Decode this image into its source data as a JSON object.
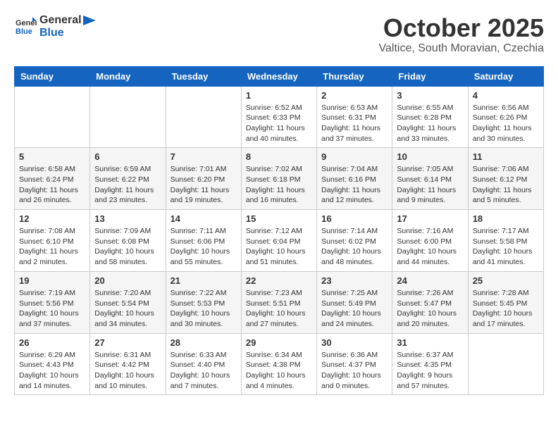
{
  "header": {
    "logo_general": "General",
    "logo_blue": "Blue",
    "month_title": "October 2025",
    "location": "Valtice, South Moravian, Czechia"
  },
  "days_of_week": [
    "Sunday",
    "Monday",
    "Tuesday",
    "Wednesday",
    "Thursday",
    "Friday",
    "Saturday"
  ],
  "weeks": [
    [
      {
        "day": "",
        "info": ""
      },
      {
        "day": "",
        "info": ""
      },
      {
        "day": "",
        "info": ""
      },
      {
        "day": "1",
        "info": "Sunrise: 6:52 AM\nSunset: 6:33 PM\nDaylight: 11 hours and 40 minutes."
      },
      {
        "day": "2",
        "info": "Sunrise: 6:53 AM\nSunset: 6:31 PM\nDaylight: 11 hours and 37 minutes."
      },
      {
        "day": "3",
        "info": "Sunrise: 6:55 AM\nSunset: 6:28 PM\nDaylight: 11 hours and 33 minutes."
      },
      {
        "day": "4",
        "info": "Sunrise: 6:56 AM\nSunset: 6:26 PM\nDaylight: 11 hours and 30 minutes."
      }
    ],
    [
      {
        "day": "5",
        "info": "Sunrise: 6:58 AM\nSunset: 6:24 PM\nDaylight: 11 hours and 26 minutes."
      },
      {
        "day": "6",
        "info": "Sunrise: 6:59 AM\nSunset: 6:22 PM\nDaylight: 11 hours and 23 minutes."
      },
      {
        "day": "7",
        "info": "Sunrise: 7:01 AM\nSunset: 6:20 PM\nDaylight: 11 hours and 19 minutes."
      },
      {
        "day": "8",
        "info": "Sunrise: 7:02 AM\nSunset: 6:18 PM\nDaylight: 11 hours and 16 minutes."
      },
      {
        "day": "9",
        "info": "Sunrise: 7:04 AM\nSunset: 6:16 PM\nDaylight: 11 hours and 12 minutes."
      },
      {
        "day": "10",
        "info": "Sunrise: 7:05 AM\nSunset: 6:14 PM\nDaylight: 11 hours and 9 minutes."
      },
      {
        "day": "11",
        "info": "Sunrise: 7:06 AM\nSunset: 6:12 PM\nDaylight: 11 hours and 5 minutes."
      }
    ],
    [
      {
        "day": "12",
        "info": "Sunrise: 7:08 AM\nSunset: 6:10 PM\nDaylight: 11 hours and 2 minutes."
      },
      {
        "day": "13",
        "info": "Sunrise: 7:09 AM\nSunset: 6:08 PM\nDaylight: 10 hours and 58 minutes."
      },
      {
        "day": "14",
        "info": "Sunrise: 7:11 AM\nSunset: 6:06 PM\nDaylight: 10 hours and 55 minutes."
      },
      {
        "day": "15",
        "info": "Sunrise: 7:12 AM\nSunset: 6:04 PM\nDaylight: 10 hours and 51 minutes."
      },
      {
        "day": "16",
        "info": "Sunrise: 7:14 AM\nSunset: 6:02 PM\nDaylight: 10 hours and 48 minutes."
      },
      {
        "day": "17",
        "info": "Sunrise: 7:16 AM\nSunset: 6:00 PM\nDaylight: 10 hours and 44 minutes."
      },
      {
        "day": "18",
        "info": "Sunrise: 7:17 AM\nSunset: 5:58 PM\nDaylight: 10 hours and 41 minutes."
      }
    ],
    [
      {
        "day": "19",
        "info": "Sunrise: 7:19 AM\nSunset: 5:56 PM\nDaylight: 10 hours and 37 minutes."
      },
      {
        "day": "20",
        "info": "Sunrise: 7:20 AM\nSunset: 5:54 PM\nDaylight: 10 hours and 34 minutes."
      },
      {
        "day": "21",
        "info": "Sunrise: 7:22 AM\nSunset: 5:53 PM\nDaylight: 10 hours and 30 minutes."
      },
      {
        "day": "22",
        "info": "Sunrise: 7:23 AM\nSunset: 5:51 PM\nDaylight: 10 hours and 27 minutes."
      },
      {
        "day": "23",
        "info": "Sunrise: 7:25 AM\nSunset: 5:49 PM\nDaylight: 10 hours and 24 minutes."
      },
      {
        "day": "24",
        "info": "Sunrise: 7:26 AM\nSunset: 5:47 PM\nDaylight: 10 hours and 20 minutes."
      },
      {
        "day": "25",
        "info": "Sunrise: 7:28 AM\nSunset: 5:45 PM\nDaylight: 10 hours and 17 minutes."
      }
    ],
    [
      {
        "day": "26",
        "info": "Sunrise: 6:29 AM\nSunset: 4:43 PM\nDaylight: 10 hours and 14 minutes."
      },
      {
        "day": "27",
        "info": "Sunrise: 6:31 AM\nSunset: 4:42 PM\nDaylight: 10 hours and 10 minutes."
      },
      {
        "day": "28",
        "info": "Sunrise: 6:33 AM\nSunset: 4:40 PM\nDaylight: 10 hours and 7 minutes."
      },
      {
        "day": "29",
        "info": "Sunrise: 6:34 AM\nSunset: 4:38 PM\nDaylight: 10 hours and 4 minutes."
      },
      {
        "day": "30",
        "info": "Sunrise: 6:36 AM\nSunset: 4:37 PM\nDaylight: 10 hours and 0 minutes."
      },
      {
        "day": "31",
        "info": "Sunrise: 6:37 AM\nSunset: 4:35 PM\nDaylight: 9 hours and 57 minutes."
      },
      {
        "day": "",
        "info": ""
      }
    ]
  ]
}
